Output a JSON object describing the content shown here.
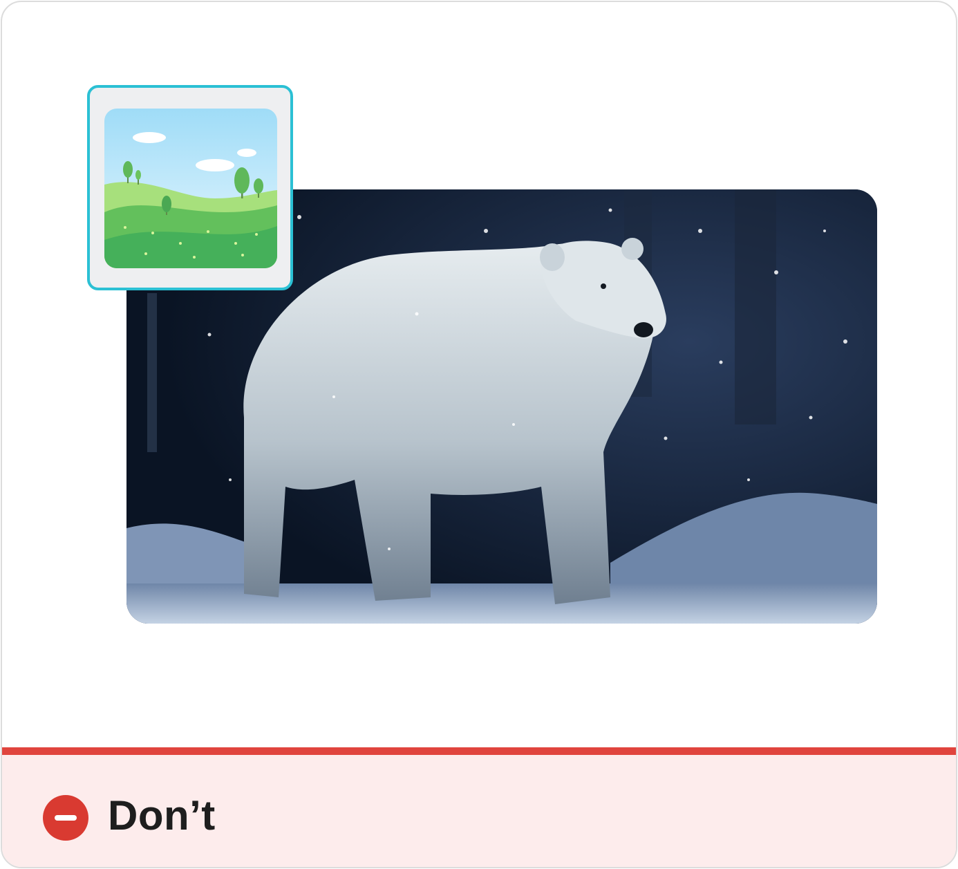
{
  "main_image": {
    "icon": "polar-bear-photo",
    "subject": "polar-bear"
  },
  "thumbnail": {
    "icon": "landscape-image-icon",
    "border_color": "#2bc0d4"
  },
  "footer": {
    "label": "Don’t",
    "icon": "minus-circle-icon",
    "accent_color": "#e0443d",
    "background_color": "#fdecec"
  }
}
